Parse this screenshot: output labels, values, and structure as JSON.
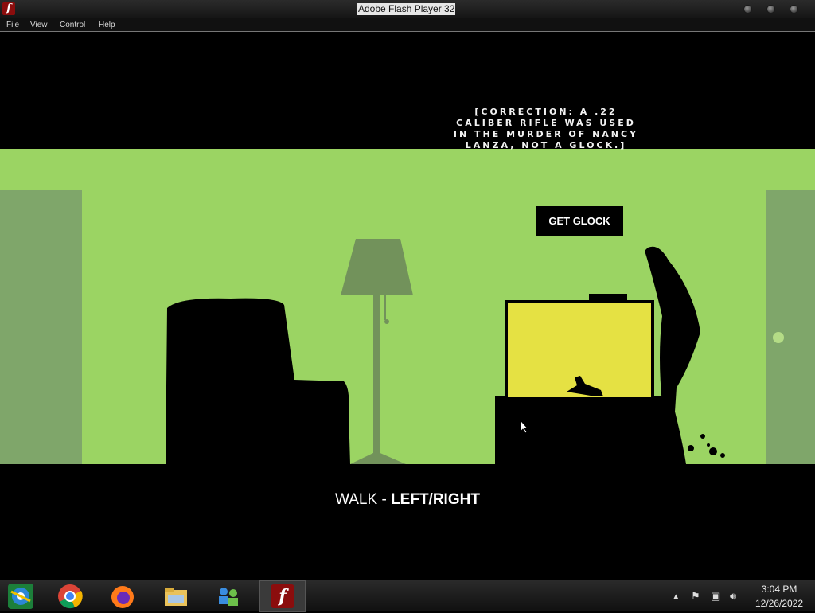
{
  "window": {
    "title": "Adobe Flash Player 32"
  },
  "menu": {
    "file": "File",
    "view": "View",
    "control": "Control",
    "help": "Help"
  },
  "game": {
    "correction": "[CORRECTION: A .22\nCALIBER RIFLE WAS USED\nIN THE MURDER OF NANCY\nLANZA, NOT A GLOCK.]",
    "button_label": "GET GLOCK",
    "instruction_action": "WALK - ",
    "instruction_keys": "LEFT/RIGHT",
    "colors": {
      "background": "#9bd463",
      "door": "#7fa66a",
      "silhouette": "#000000",
      "lamp": "#72925b",
      "tv_screen": "#e5e143"
    }
  },
  "taskbar": {
    "apps": [
      "ie-icon",
      "chrome-icon",
      "firefox-icon",
      "file-explorer-icon",
      "network-people-icon",
      "flash-player-icon"
    ],
    "clock": {
      "time": "3:04 PM",
      "date": "12/26/2022"
    }
  }
}
